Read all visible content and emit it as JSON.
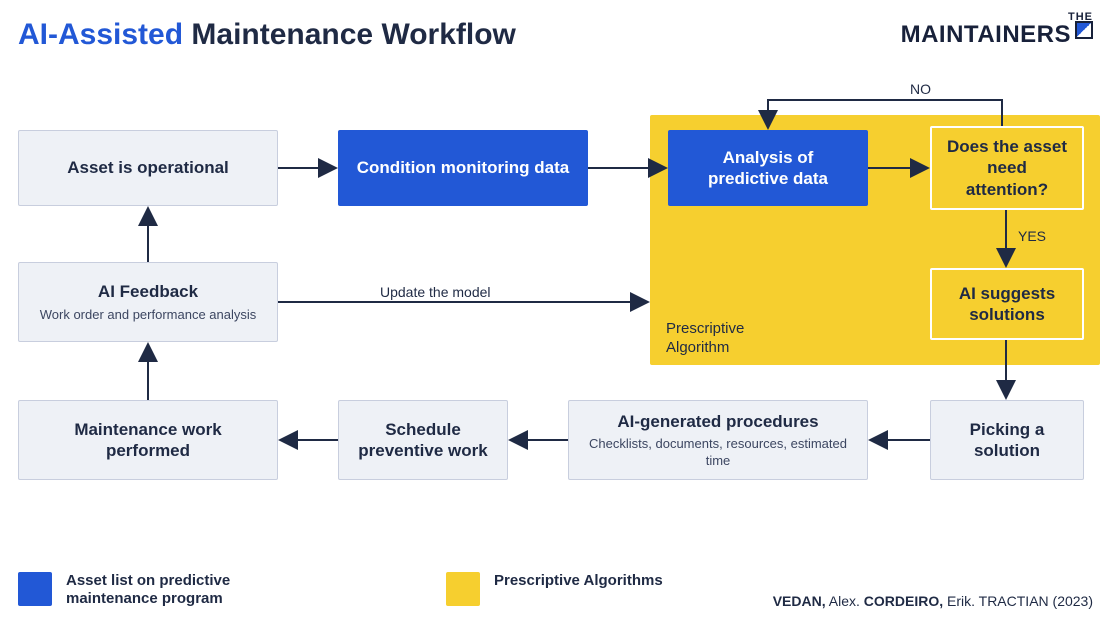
{
  "title_blue": "AI-Assisted",
  "title_rest": "Maintenance Workflow",
  "logo": {
    "line1": "THE",
    "line2": "MAINTAINERS"
  },
  "nodes": {
    "asset_operational": "Asset is operational",
    "condition_monitoring": "Condition monitoring data",
    "analysis_predictive": "Analysis of predictive data",
    "attention_question": "Does the asset need attention?",
    "ai_suggests": "AI suggests solutions",
    "picking_solution": "Picking a solution",
    "ai_procedures_title": "AI-generated procedures",
    "ai_procedures_sub": "Checklists, documents, resources, estimated time",
    "schedule_preventive": "Schedule preventive work",
    "maintenance_performed": "Maintenance work performed",
    "ai_feedback_title": "AI Feedback",
    "ai_feedback_sub": "Work order and performance analysis"
  },
  "region_label": "Prescriptive Algorithm",
  "edge_labels": {
    "no": "NO",
    "yes": "YES",
    "update": "Update the model"
  },
  "legend": {
    "blue": "Asset list on predictive maintenance program",
    "yellow": "Prescriptive Algorithms"
  },
  "citation": {
    "bold1": "VEDAN,",
    "plain1": " Alex. ",
    "bold2": "CORDEIRO,",
    "plain2": " Erik. ",
    "plain3": "TRACTIAN (2023)"
  },
  "chart_data": {
    "type": "flowchart",
    "title": "AI-Assisted Maintenance Workflow",
    "nodes": [
      {
        "id": "asset_operational",
        "label": "Asset is operational",
        "group": null
      },
      {
        "id": "condition_monitoring",
        "label": "Condition monitoring data",
        "group": "predictive"
      },
      {
        "id": "analysis_predictive",
        "label": "Analysis of predictive data",
        "group": "predictive_and_prescriptive"
      },
      {
        "id": "attention_question",
        "label": "Does the asset need attention?",
        "group": "prescriptive",
        "decision": true
      },
      {
        "id": "ai_suggests",
        "label": "AI suggests solutions",
        "group": "prescriptive"
      },
      {
        "id": "picking_solution",
        "label": "Picking a solution",
        "group": null
      },
      {
        "id": "ai_procedures",
        "label": "AI-generated procedures",
        "sublabel": "Checklists, documents, resources, estimated time",
        "group": null
      },
      {
        "id": "schedule_preventive",
        "label": "Schedule preventive work",
        "group": null
      },
      {
        "id": "maintenance_performed",
        "label": "Maintenance work performed",
        "group": null
      },
      {
        "id": "ai_feedback",
        "label": "AI Feedback",
        "sublabel": "Work order and performance analysis",
        "group": null
      }
    ],
    "edges": [
      {
        "from": "asset_operational",
        "to": "condition_monitoring"
      },
      {
        "from": "condition_monitoring",
        "to": "analysis_predictive"
      },
      {
        "from": "analysis_predictive",
        "to": "attention_question"
      },
      {
        "from": "attention_question",
        "to": "analysis_predictive",
        "label": "NO"
      },
      {
        "from": "attention_question",
        "to": "ai_suggests",
        "label": "YES"
      },
      {
        "from": "ai_suggests",
        "to": "picking_solution"
      },
      {
        "from": "picking_solution",
        "to": "ai_procedures"
      },
      {
        "from": "ai_procedures",
        "to": "schedule_preventive"
      },
      {
        "from": "schedule_preventive",
        "to": "maintenance_performed"
      },
      {
        "from": "maintenance_performed",
        "to": "ai_feedback"
      },
      {
        "from": "ai_feedback",
        "to": "asset_operational"
      },
      {
        "from": "ai_feedback",
        "to": "analysis_predictive",
        "label": "Update the model"
      }
    ],
    "groups": {
      "predictive": {
        "label": "Asset list on predictive maintenance program",
        "color": "#2258d6"
      },
      "prescriptive": {
        "label": "Prescriptive Algorithms",
        "color": "#f6cf2f"
      }
    }
  }
}
